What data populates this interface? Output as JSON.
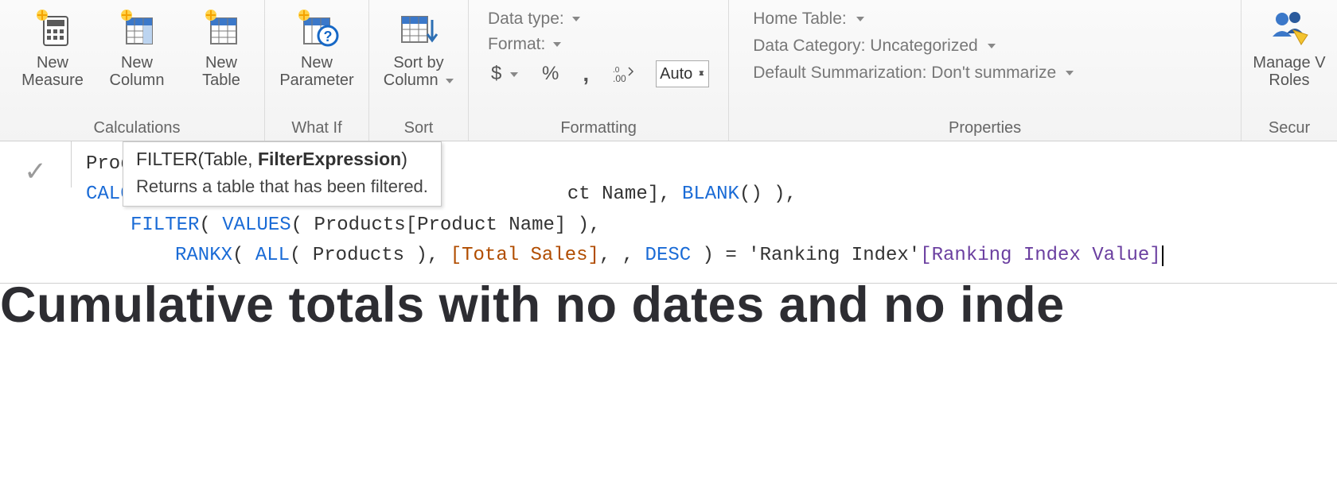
{
  "ribbon": {
    "calculations": {
      "title": "Calculations",
      "new_measure": "New\nMeasure",
      "new_column": "New\nColumn",
      "new_table": "New\nTable"
    },
    "whatif": {
      "title": "What If",
      "new_parameter": "New\nParameter"
    },
    "sort": {
      "title": "Sort",
      "sort_by_column": "Sort by\nColumn"
    },
    "formatting": {
      "title": "Formatting",
      "data_type_label": "Data type:",
      "format_label": "Format:",
      "currency_btn": "$",
      "percent_btn": "%",
      "thousand_btn": ",",
      "decimal_btn": ".00",
      "auto_value": "Auto"
    },
    "properties": {
      "title": "Properties",
      "home_table_label": "Home Table:",
      "data_category_label": "Data Category: Uncategorized",
      "default_summarization_label": "Default Summarization: Don't summarize"
    },
    "security": {
      "title": "Secur",
      "manage_roles": "Manage V\nRoles"
    }
  },
  "formula": {
    "line1_prefix": "Prod",
    "line2_prefix": "CALC",
    "line2_suffix_plain": "ct Name], ",
    "line2_blank": "BLANK",
    "line2_tail": "() ),",
    "line3_filter": "FILTER",
    "line3_values": "VALUES",
    "line3_table": " Products",
    "line3_col": "[Product Name]",
    "line3_tail": " ),",
    "line4_rankx": "RANKX",
    "line4_all": "ALL",
    "line4_products": " Products ",
    "line4_totalsales": "[Total Sales]",
    "line4_desc": "DESC",
    "line4_eq": " ) = ",
    "line4_table2": "'Ranking Index'",
    "line4_col2": "[Ranking Index Value]"
  },
  "tooltip": {
    "sig_pre": "FILTER(Table, ",
    "sig_bold": "FilterExpression",
    "sig_post": ")",
    "desc": "Returns a table that has been filtered."
  },
  "page": {
    "headline": "Cumulative totals with no dates and no inde"
  }
}
